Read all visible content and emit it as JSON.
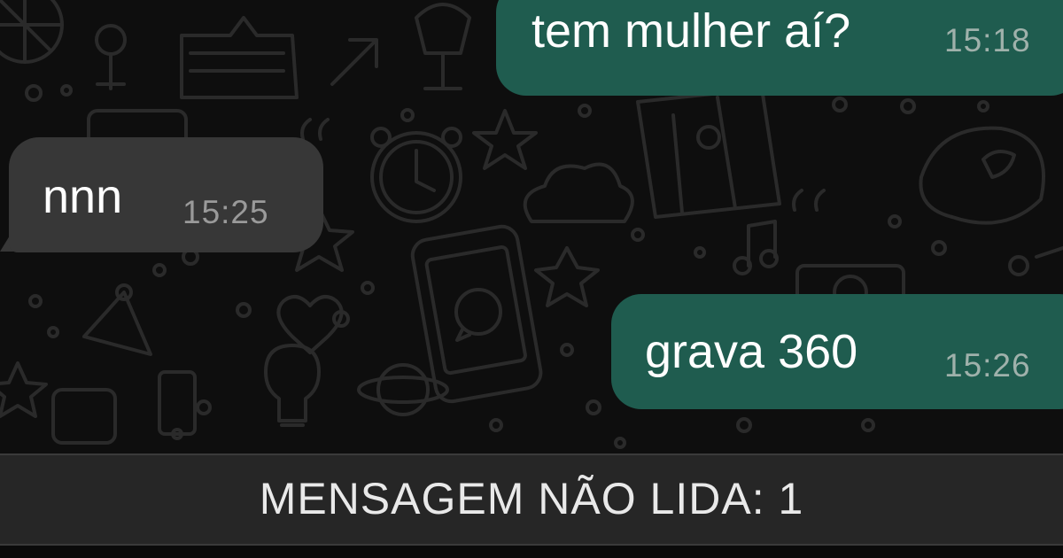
{
  "messages": [
    {
      "direction": "outgoing",
      "text": "tem mulher aí?",
      "time": "15:18"
    },
    {
      "direction": "incoming",
      "text": "nnn",
      "time": "15:25"
    },
    {
      "direction": "outgoing",
      "text": "grava 360",
      "time": "15:26"
    }
  ],
  "unread_banner": {
    "label": "MENSAGEM NÃO LIDA: 1"
  },
  "colors": {
    "background": "#0e0e0e",
    "outgoing_bubble": "#1f5c4f",
    "incoming_bubble": "#373737",
    "banner": "#262626",
    "doodle_stroke": "#2a2a2a"
  },
  "wallpaper": {
    "icons": [
      "lollipop-icon",
      "thumbs-up-icon",
      "arrow-icon",
      "star-icon",
      "clock-icon",
      "cloud-icon",
      "map-icon",
      "quote-icon",
      "music-note-icon",
      "phone-icon",
      "whatsapp-icon",
      "heart-icon",
      "planet-icon",
      "camera-icon",
      "trophy-icon",
      "bird-icon",
      "party-hat-icon",
      "lightbulb-icon"
    ]
  }
}
